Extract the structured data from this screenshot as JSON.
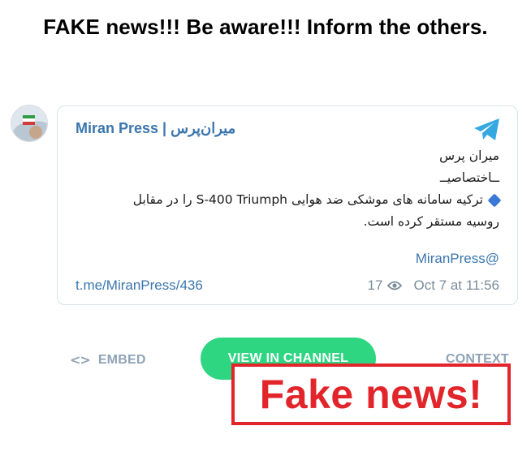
{
  "headline": "FAKE news!!! Be aware!!! Inform the others.",
  "post": {
    "channel_name": "Miran Press | میران‌پرس",
    "message_lines": [
      "میران پرس",
      "ــاختصاصیــ",
      "ترکیه سامانه های موشکی ضد هوایی S-400 Triumph را در مقابل",
      "روسیه مستقر کرده است."
    ],
    "handle": "@MiranPress",
    "link": "t.me/MiranPress/436",
    "views": "17",
    "date": "Oct 7 at 11:56"
  },
  "actions": {
    "embed_label": "EMBED",
    "embed_icon": "<>",
    "view_label": "VIEW IN CHANNEL",
    "context_label": "CONTEXT"
  },
  "stamp": "Fake news!",
  "colors": {
    "link_blue": "#3b76ad",
    "button_green": "#2fd682",
    "muted_gray": "#8fa3b7",
    "stamp_red": "#e1252b"
  },
  "icons": [
    "telegram-icon",
    "eye-icon",
    "code-icon",
    "diamond-icon"
  ]
}
